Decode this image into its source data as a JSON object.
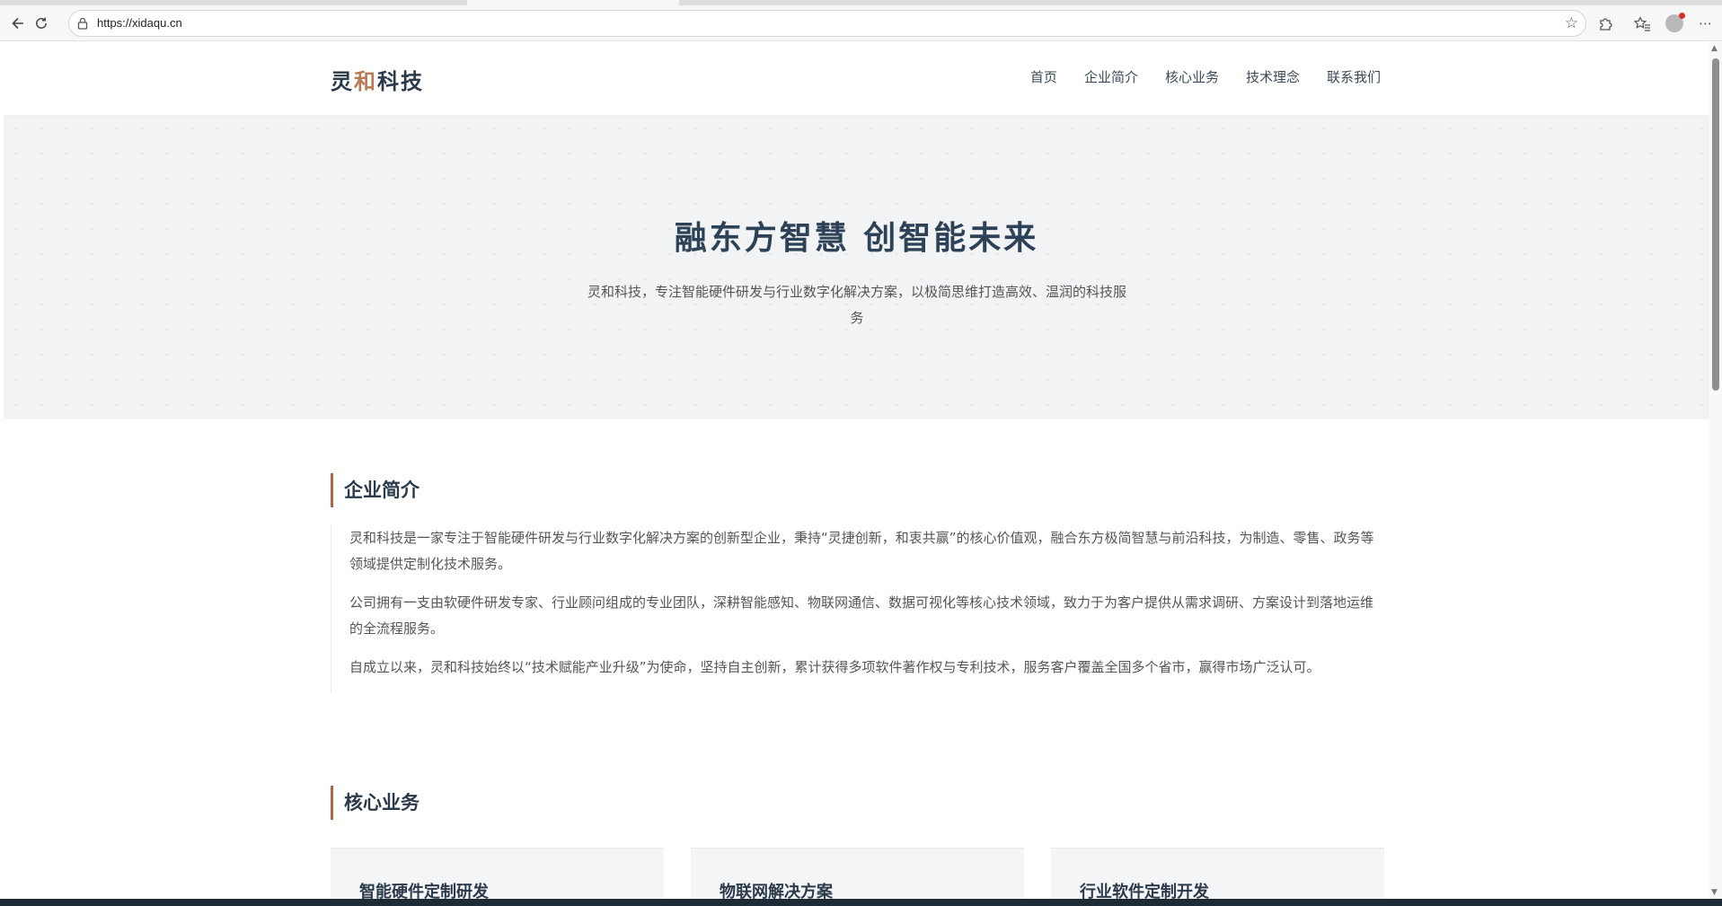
{
  "browser": {
    "url": "https://xidaqu.cn"
  },
  "site": {
    "logo_part1": "灵",
    "logo_accent": "和",
    "logo_part2": "科技",
    "nav": [
      {
        "label": "首页"
      },
      {
        "label": "企业简介"
      },
      {
        "label": "核心业务"
      },
      {
        "label": "技术理念"
      },
      {
        "label": "联系我们"
      }
    ]
  },
  "hero": {
    "title": "融东方智慧 创智能未来",
    "subtitle": "灵和科技，专注智能硬件研发与行业数字化解决方案，以极简思维打造高效、温润的科技服务"
  },
  "about": {
    "title": "企业简介",
    "paragraphs": [
      "灵和科技是一家专注于智能硬件研发与行业数字化解决方案的创新型企业，秉持“灵捷创新，和衷共赢”的核心价值观，融合东方极简智慧与前沿科技，为制造、零售、政务等领域提供定制化技术服务。",
      "公司拥有一支由软硬件研发专家、行业顾问组成的专业团队，深耕智能感知、物联网通信、数据可视化等核心技术领域，致力于为客户提供从需求调研、方案设计到落地运维的全流程服务。",
      "自成立以来，灵和科技始终以“技术赋能产业升级”为使命，坚持自主创新，累计获得多项软件著作权与专利技术，服务客户覆盖全国多个省市，赢得市场广泛认可。"
    ]
  },
  "business": {
    "title": "核心业务",
    "cards": [
      {
        "title": "智能硬件定制研发"
      },
      {
        "title": "物联网解决方案"
      },
      {
        "title": "行业软件定制开发"
      }
    ]
  },
  "icons": {
    "back": "back-arrow-icon",
    "reload": "reload-icon",
    "lock": "lock-icon",
    "bookmark": "star-icon",
    "extensions": "puzzle-icon",
    "favorites": "favorites-icon",
    "profile": "profile-avatar-icon",
    "menu": "more-icon"
  }
}
